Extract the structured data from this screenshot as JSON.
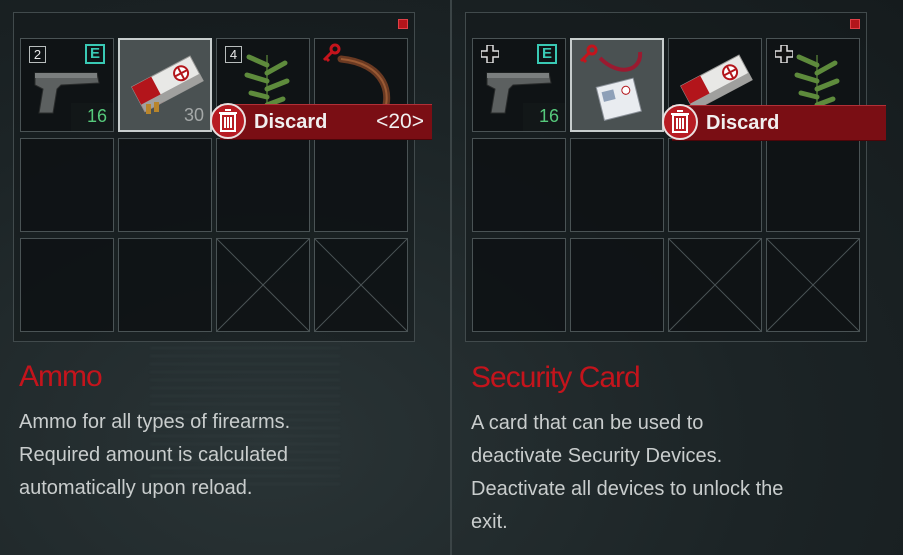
{
  "left_panel": {
    "slots": [
      {
        "item": "handgun",
        "count_badge": "2",
        "equip_badge": "E",
        "quantity": "16"
      },
      {
        "item": "ammo",
        "quantity": "30",
        "selected": true
      },
      {
        "item": "green-herb",
        "count_badge": "4"
      },
      {
        "item": "chain-part",
        "has_key_icon": true
      }
    ],
    "discard": {
      "label": "Discard",
      "amount": "<20>"
    },
    "title": "Ammo",
    "description": [
      "Ammo for all types of firearms.",
      "Required amount is calculated",
      "automatically upon reload."
    ]
  },
  "right_panel": {
    "slots": [
      {
        "item": "handgun",
        "equip_badge": "E",
        "quantity": "16",
        "has_cross_icon": true
      },
      {
        "item": "security-card",
        "selected": true,
        "has_key_icon": true
      },
      {
        "item": "ammo"
      },
      {
        "item": "green-herb",
        "has_cross_icon": true
      }
    ],
    "discard": {
      "label": "Discard"
    },
    "title": "Security Card",
    "description": [
      "A card that can be used to",
      "deactivate Security Devices.",
      "Deactivate all devices to unlock the",
      "exit."
    ]
  },
  "colors": {
    "accent_red": "#c4141c",
    "equip_teal": "#39c9b4",
    "qty_green": "#56c97b"
  }
}
